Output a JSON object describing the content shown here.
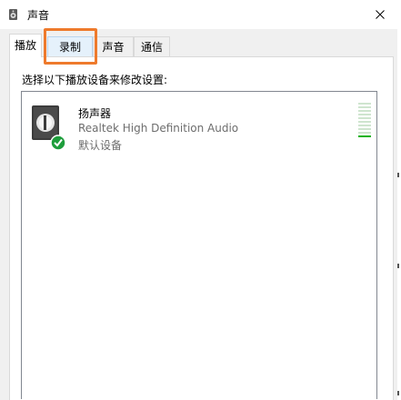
{
  "window": {
    "title": "声音",
    "title_icon": "speaker-icon",
    "close_icon": "close-icon"
  },
  "tabs": [
    {
      "label": "播放",
      "selected": true
    },
    {
      "label": "录制",
      "selected": false,
      "highlighted": true
    },
    {
      "label": "声音",
      "selected": false
    },
    {
      "label": "通信",
      "selected": false
    }
  ],
  "panel": {
    "instruction": "选择以下播放设备来修改设置:"
  },
  "device": {
    "name": "扬声器",
    "description": "Realtek High Definition Audio",
    "status": "默认设备",
    "icon": "speaker-device-icon",
    "badge": "default-check-icon",
    "level_meter": {
      "bars": 10,
      "active_bars": 1
    }
  },
  "colors": {
    "highlight": "#ee7a2c",
    "check_badge": "#1e9e3c",
    "meter_active": "#12b312"
  }
}
